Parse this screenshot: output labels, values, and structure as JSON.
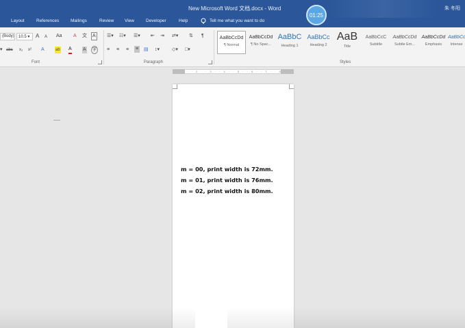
{
  "window": {
    "title": "New Microsoft Word 文档.docx - Word",
    "user": "朱 冬阳",
    "timer": "01:25"
  },
  "tabs": [
    "Layout",
    "References",
    "Mailings",
    "Review",
    "View",
    "Developer",
    "Help"
  ],
  "tell_me": "Tell me what you want to do",
  "ribbon": {
    "font": {
      "name": "(Body)",
      "size": "10.5",
      "group_label": "Font",
      "grow": "A",
      "shrink": "A",
      "case": "Aa",
      "clear": "A",
      "phonetic": "文",
      "border": "A",
      "strike": "abc",
      "subscript": "x₂",
      "superscript": "x²",
      "effects": "A",
      "highlight": "ab",
      "color": "A",
      "char_shading": "A",
      "enclose": "字"
    },
    "paragraph": {
      "group_label": "Paragraph"
    },
    "styles": {
      "group_label": "Styles",
      "items": [
        {
          "preview": "AaBbCcDd",
          "name": "¶ Normal"
        },
        {
          "preview": "AaBbCcDd",
          "name": "¶ No Spac..."
        },
        {
          "preview": "AaBbC",
          "name": "Heading 1"
        },
        {
          "preview": "AaBbCc",
          "name": "Heading 2"
        },
        {
          "preview": "AaB",
          "name": "Title"
        },
        {
          "preview": "AaBbCcC",
          "name": "Subtitle"
        },
        {
          "preview": "AaBbCcDd",
          "name": "Subtle Em..."
        },
        {
          "preview": "AaBbCcDd",
          "name": "Emphasis"
        },
        {
          "preview": "AaBbCcDd",
          "name": "Intense"
        }
      ]
    }
  },
  "document": {
    "lines": [
      "m = 00, print width is 72mm.",
      "m = 01, print width is 76mm.",
      "m = 02, print width is 80mm."
    ]
  },
  "colors": {
    "accent": "#2b579a",
    "ribbon_bg": "#f3f3f3",
    "canvas_bg": "#e6e6e6",
    "font_color": "#e01818",
    "highlight": "#f7e53a",
    "timer_bg": "#5ba7e6"
  }
}
